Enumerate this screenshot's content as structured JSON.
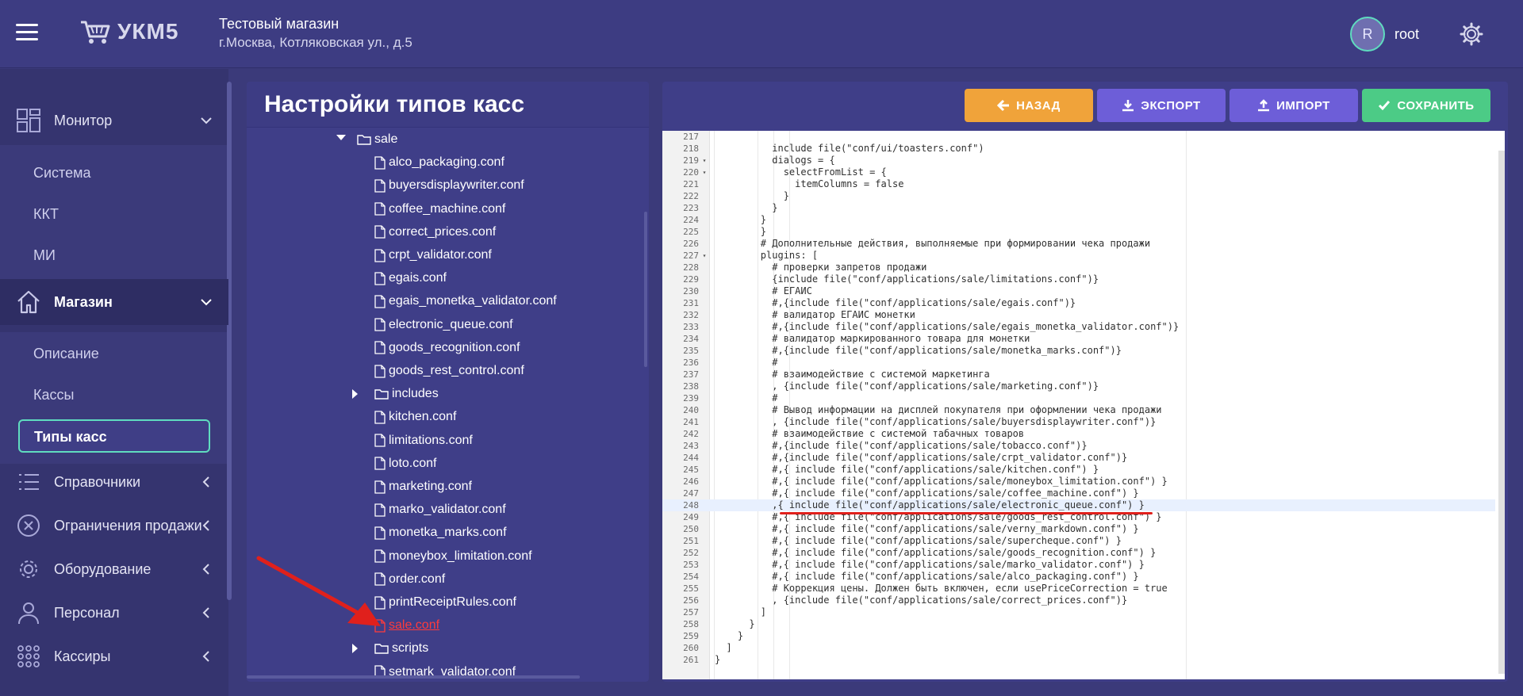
{
  "header": {
    "logo_text": "УКМ5",
    "shop_name": "Тестовый магазин",
    "shop_address": "г.Москва, Котляковская ул., д.5",
    "avatar_letter": "R",
    "username": "root"
  },
  "sidebar": {
    "sections": [
      {
        "label": "Монитор",
        "icon": "grid-icon",
        "expanded": true
      },
      {
        "label": "Магазин",
        "icon": "home-icon",
        "expanded": true
      },
      {
        "label": "Справочники",
        "icon": "list-icon",
        "expanded": false
      },
      {
        "label": "Ограничения продажи",
        "icon": "x-circle-icon",
        "expanded": false
      },
      {
        "label": "Оборудование",
        "icon": "gear-icon",
        "expanded": false
      },
      {
        "label": "Персонал",
        "icon": "person-icon",
        "expanded": false
      },
      {
        "label": "Кассиры",
        "icon": "dots-grid-icon",
        "expanded": false
      }
    ],
    "monitor_items": [
      "Система",
      "ККТ",
      "МИ"
    ],
    "shop_items": [
      "Описание",
      "Кассы",
      "Типы касс"
    ],
    "active_item": "Типы касс"
  },
  "tree": {
    "title": "Настройки типов касс",
    "rows": [
      {
        "type": "folder",
        "label": "sale",
        "expanded": true
      },
      {
        "type": "file",
        "label": "alco_packaging.conf"
      },
      {
        "type": "file",
        "label": "buyersdisplaywriter.conf"
      },
      {
        "type": "file",
        "label": "coffee_machine.conf"
      },
      {
        "type": "file",
        "label": "correct_prices.conf"
      },
      {
        "type": "file",
        "label": "crpt_validator.conf"
      },
      {
        "type": "file",
        "label": "egais.conf"
      },
      {
        "type": "file",
        "label": "egais_monetka_validator.conf"
      },
      {
        "type": "file",
        "label": "electronic_queue.conf"
      },
      {
        "type": "file",
        "label": "goods_recognition.conf"
      },
      {
        "type": "file",
        "label": "goods_rest_control.conf"
      },
      {
        "type": "folder",
        "label": "includes",
        "expanded": false
      },
      {
        "type": "file",
        "label": "kitchen.conf"
      },
      {
        "type": "file",
        "label": "limitations.conf"
      },
      {
        "type": "file",
        "label": "loto.conf"
      },
      {
        "type": "file",
        "label": "marketing.conf"
      },
      {
        "type": "file",
        "label": "marko_validator.conf"
      },
      {
        "type": "file",
        "label": "monetka_marks.conf"
      },
      {
        "type": "file",
        "label": "moneybox_limitation.conf"
      },
      {
        "type": "file",
        "label": "order.conf"
      },
      {
        "type": "file",
        "label": "printReceiptRules.conf"
      },
      {
        "type": "file",
        "label": "sale.conf",
        "selected": true
      },
      {
        "type": "folder",
        "label": "scripts",
        "expanded": false
      },
      {
        "type": "file",
        "label": "setmark_validator.conf"
      }
    ]
  },
  "toolbar": {
    "back_label": "НАЗАД",
    "export_label": "ЭКСПОРТ",
    "import_label": "ИМПОРТ",
    "save_label": "СОХРАНИТЬ"
  },
  "editor": {
    "highlighted_line": 248,
    "lines": [
      {
        "n": 217,
        "t": "",
        "c": "tx"
      },
      {
        "n": 218,
        "t": "          include file(\"conf/ui/toasters.conf\")",
        "c": "kw"
      },
      {
        "n": 219,
        "t": "          dialogs = {",
        "c": "kw",
        "fold": true
      },
      {
        "n": 220,
        "t": "            selectFromList = {",
        "c": "kw",
        "fold": true
      },
      {
        "n": 221,
        "t": "              itemColumns = false",
        "c": "kw"
      },
      {
        "n": 222,
        "t": "            }",
        "c": "tx"
      },
      {
        "n": 223,
        "t": "          }",
        "c": "tx"
      },
      {
        "n": 224,
        "t": "        }",
        "c": "tx"
      },
      {
        "n": 225,
        "t": "        }",
        "c": "tx"
      },
      {
        "n": 226,
        "t": "        # Дополнительные действия, выполняемые при формировании чека продажи",
        "c": "cm"
      },
      {
        "n": 227,
        "t": "        plugins: [",
        "c": "kw",
        "fold": true
      },
      {
        "n": 228,
        "t": "          # проверки запретов продажи",
        "c": "cm"
      },
      {
        "n": 229,
        "t": "          {include file(\"conf/applications/sale/limitations.conf\")}",
        "c": "kw"
      },
      {
        "n": 230,
        "t": "          # ЕГАИС",
        "c": "cm"
      },
      {
        "n": 231,
        "t": "          #,{include file(\"conf/applications/sale/egais.conf\")}",
        "c": "cm"
      },
      {
        "n": 232,
        "t": "          # валидатор ЕГАИС монетки",
        "c": "cm"
      },
      {
        "n": 233,
        "t": "          #,{include file(\"conf/applications/sale/egais_monetka_validator.conf\")}",
        "c": "cm"
      },
      {
        "n": 234,
        "t": "          # валидатор маркированного товара для монетки",
        "c": "cm"
      },
      {
        "n": 235,
        "t": "          #,{include file(\"conf/applications/sale/monetka_marks.conf\")}",
        "c": "cm"
      },
      {
        "n": 236,
        "t": "          #",
        "c": "cm"
      },
      {
        "n": 237,
        "t": "          # взаимодействие с системой маркетинга",
        "c": "cm"
      },
      {
        "n": 238,
        "t": "          , {include file(\"conf/applications/sale/marketing.conf\")}",
        "c": "kw"
      },
      {
        "n": 239,
        "t": "          #",
        "c": "cm"
      },
      {
        "n": 240,
        "t": "          # Вывод информации на дисплей покупателя при оформлении чека продажи",
        "c": "cm"
      },
      {
        "n": 241,
        "t": "          , {include file(\"conf/applications/sale/buyersdisplaywriter.conf\")}",
        "c": "kw"
      },
      {
        "n": 242,
        "t": "          # взаимодействие с системой табачных товаров",
        "c": "cm"
      },
      {
        "n": 243,
        "t": "          #,{include file(\"conf/applications/sale/tobacco.conf\")}",
        "c": "cm"
      },
      {
        "n": 244,
        "t": "          #,{include file(\"conf/applications/sale/crpt_validator.conf\")}",
        "c": "cm"
      },
      {
        "n": 245,
        "t": "          #,{ include file(\"conf/applications/sale/kitchen.conf\") }",
        "c": "cm"
      },
      {
        "n": 246,
        "t": "          #,{ include file(\"conf/applications/sale/moneybox_limitation.conf\") }",
        "c": "cm"
      },
      {
        "n": 247,
        "t": "          #,{ include file(\"conf/applications/sale/coffee_machine.conf\") }",
        "c": "cm"
      },
      {
        "n": 248,
        "t": "          ,{ include file(\"conf/applications/sale/electronic_queue.conf\") }",
        "c": "kw"
      },
      {
        "n": 249,
        "t": "          #,{ include file(\"conf/applications/sale/goods_rest_control.conf\") }",
        "c": "cm"
      },
      {
        "n": 250,
        "t": "          #,{ include file(\"conf/applications/sale/verny_markdown.conf\") }",
        "c": "cm"
      },
      {
        "n": 251,
        "t": "          #,{ include file(\"conf/applications/sale/supercheque.conf\") }",
        "c": "cm"
      },
      {
        "n": 252,
        "t": "          #,{ include file(\"conf/applications/sale/goods_recognition.conf\") }",
        "c": "cm"
      },
      {
        "n": 253,
        "t": "          #,{ include file(\"conf/applications/sale/marko_validator.conf\") }",
        "c": "cm"
      },
      {
        "n": 254,
        "t": "          #,{ include file(\"conf/applications/sale/alco_packaging.conf\") }",
        "c": "cm"
      },
      {
        "n": 255,
        "t": "          # Коррекция цены. Должен быть включен, если usePriceCorrection = true",
        "c": "cm"
      },
      {
        "n": 256,
        "t": "          , {include file(\"conf/applications/sale/correct_prices.conf\")}",
        "c": "kw"
      },
      {
        "n": 257,
        "t": "        ]",
        "c": "tx"
      },
      {
        "n": 258,
        "t": "      }",
        "c": "tx"
      },
      {
        "n": 259,
        "t": "    }",
        "c": "tx"
      },
      {
        "n": 260,
        "t": "  ]",
        "c": "tx"
      },
      {
        "n": 261,
        "t": "}",
        "c": "tx"
      }
    ]
  },
  "colors": {
    "accent": "#5fdcbf",
    "back": "#f0a33a",
    "export_import": "#6d5ed8",
    "save": "#4ccb86",
    "selected_file": "#ff3b3b",
    "annotation": "#e0201c"
  }
}
